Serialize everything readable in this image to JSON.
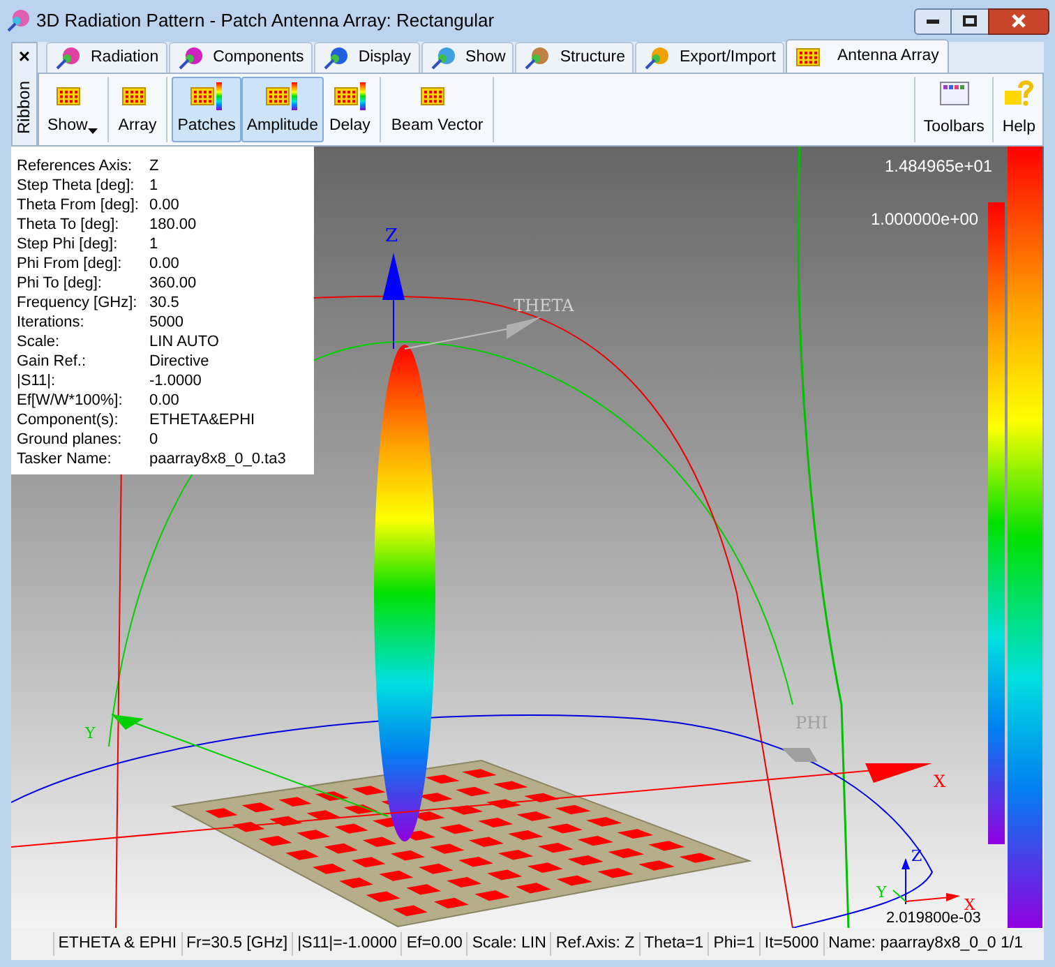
{
  "window": {
    "title": "3D Radiation Pattern - Patch Antenna Array: Rectangular"
  },
  "ribbon_toggle": {
    "close": "×",
    "label": "Ribbon"
  },
  "tabs": [
    {
      "label": "Radiation",
      "selected": false
    },
    {
      "label": "Components",
      "selected": false
    },
    {
      "label": "Display",
      "selected": false
    },
    {
      "label": "Show",
      "selected": false
    },
    {
      "label": "Structure",
      "selected": false
    },
    {
      "label": "Export/Import",
      "selected": false
    },
    {
      "label": "Antenna Array",
      "selected": true
    }
  ],
  "toolbar": {
    "buttons": [
      {
        "label": "Show",
        "selected": false,
        "dropdown": true
      },
      {
        "label": "Array",
        "selected": false,
        "dropdown": false
      },
      {
        "label": "Patches",
        "selected": true,
        "dropdown": false
      },
      {
        "label": "Amplitude",
        "selected": true,
        "dropdown": false
      },
      {
        "label": "Delay",
        "selected": false,
        "dropdown": false
      },
      {
        "label": "Beam Vector",
        "selected": false,
        "dropdown": false
      }
    ],
    "right_buttons": [
      {
        "label": "Toolbars"
      },
      {
        "label": "Help"
      }
    ]
  },
  "info_panel": {
    "rows": [
      {
        "label": "References Axis:",
        "value": "Z"
      },
      {
        "label": "Step Theta [deg]:",
        "value": "1"
      },
      {
        "label": "Theta From [deg]:",
        "value": "0.00"
      },
      {
        "label": "Theta To [deg]:",
        "value": "180.00"
      },
      {
        "label": "Step Phi [deg]:",
        "value": "1"
      },
      {
        "label": "Phi From [deg]:",
        "value": "0.00"
      },
      {
        "label": "Phi To [deg]:",
        "value": "360.00"
      },
      {
        "label": "Frequency [GHz]:",
        "value": "30.5"
      },
      {
        "label": "Iterations:",
        "value": "5000"
      },
      {
        "label": "Scale:",
        "value": "LIN AUTO"
      },
      {
        "label": "Gain Ref.:",
        "value": "Directive"
      },
      {
        "label": "|S11|:",
        "value": "-1.0000"
      },
      {
        "label": "Ef[W/W*100%]:",
        "value": "0.00"
      },
      {
        "label": "Component(s):",
        "value": "ETHETA&EPHI"
      },
      {
        "label": "Ground planes:",
        "value": "0"
      },
      {
        "label": "Tasker Name:",
        "value": "paarray8x8_0_0.ta3"
      }
    ]
  },
  "viewport": {
    "axis_labels": {
      "z": "Z",
      "theta": "THETA",
      "phi": "PHI",
      "x": "X",
      "y": "Y"
    },
    "mini_axes": {
      "z": "Z",
      "x": "X",
      "y": "Y"
    },
    "min_value": "2.019800e-03",
    "legend": {
      "max": "1.484965e+01",
      "reference": "1.000000e+00"
    }
  },
  "status_bar": [
    "ETHETA & EPHI",
    "Fr=30.5 [GHz]",
    "|S11|=-1.0000",
    "Ef=0.00",
    "Scale: LIN",
    "Ref.Axis: Z",
    "Theta=1",
    "Phi=1",
    "It=5000",
    "Name: paarray8x8_0_0 1/1"
  ]
}
